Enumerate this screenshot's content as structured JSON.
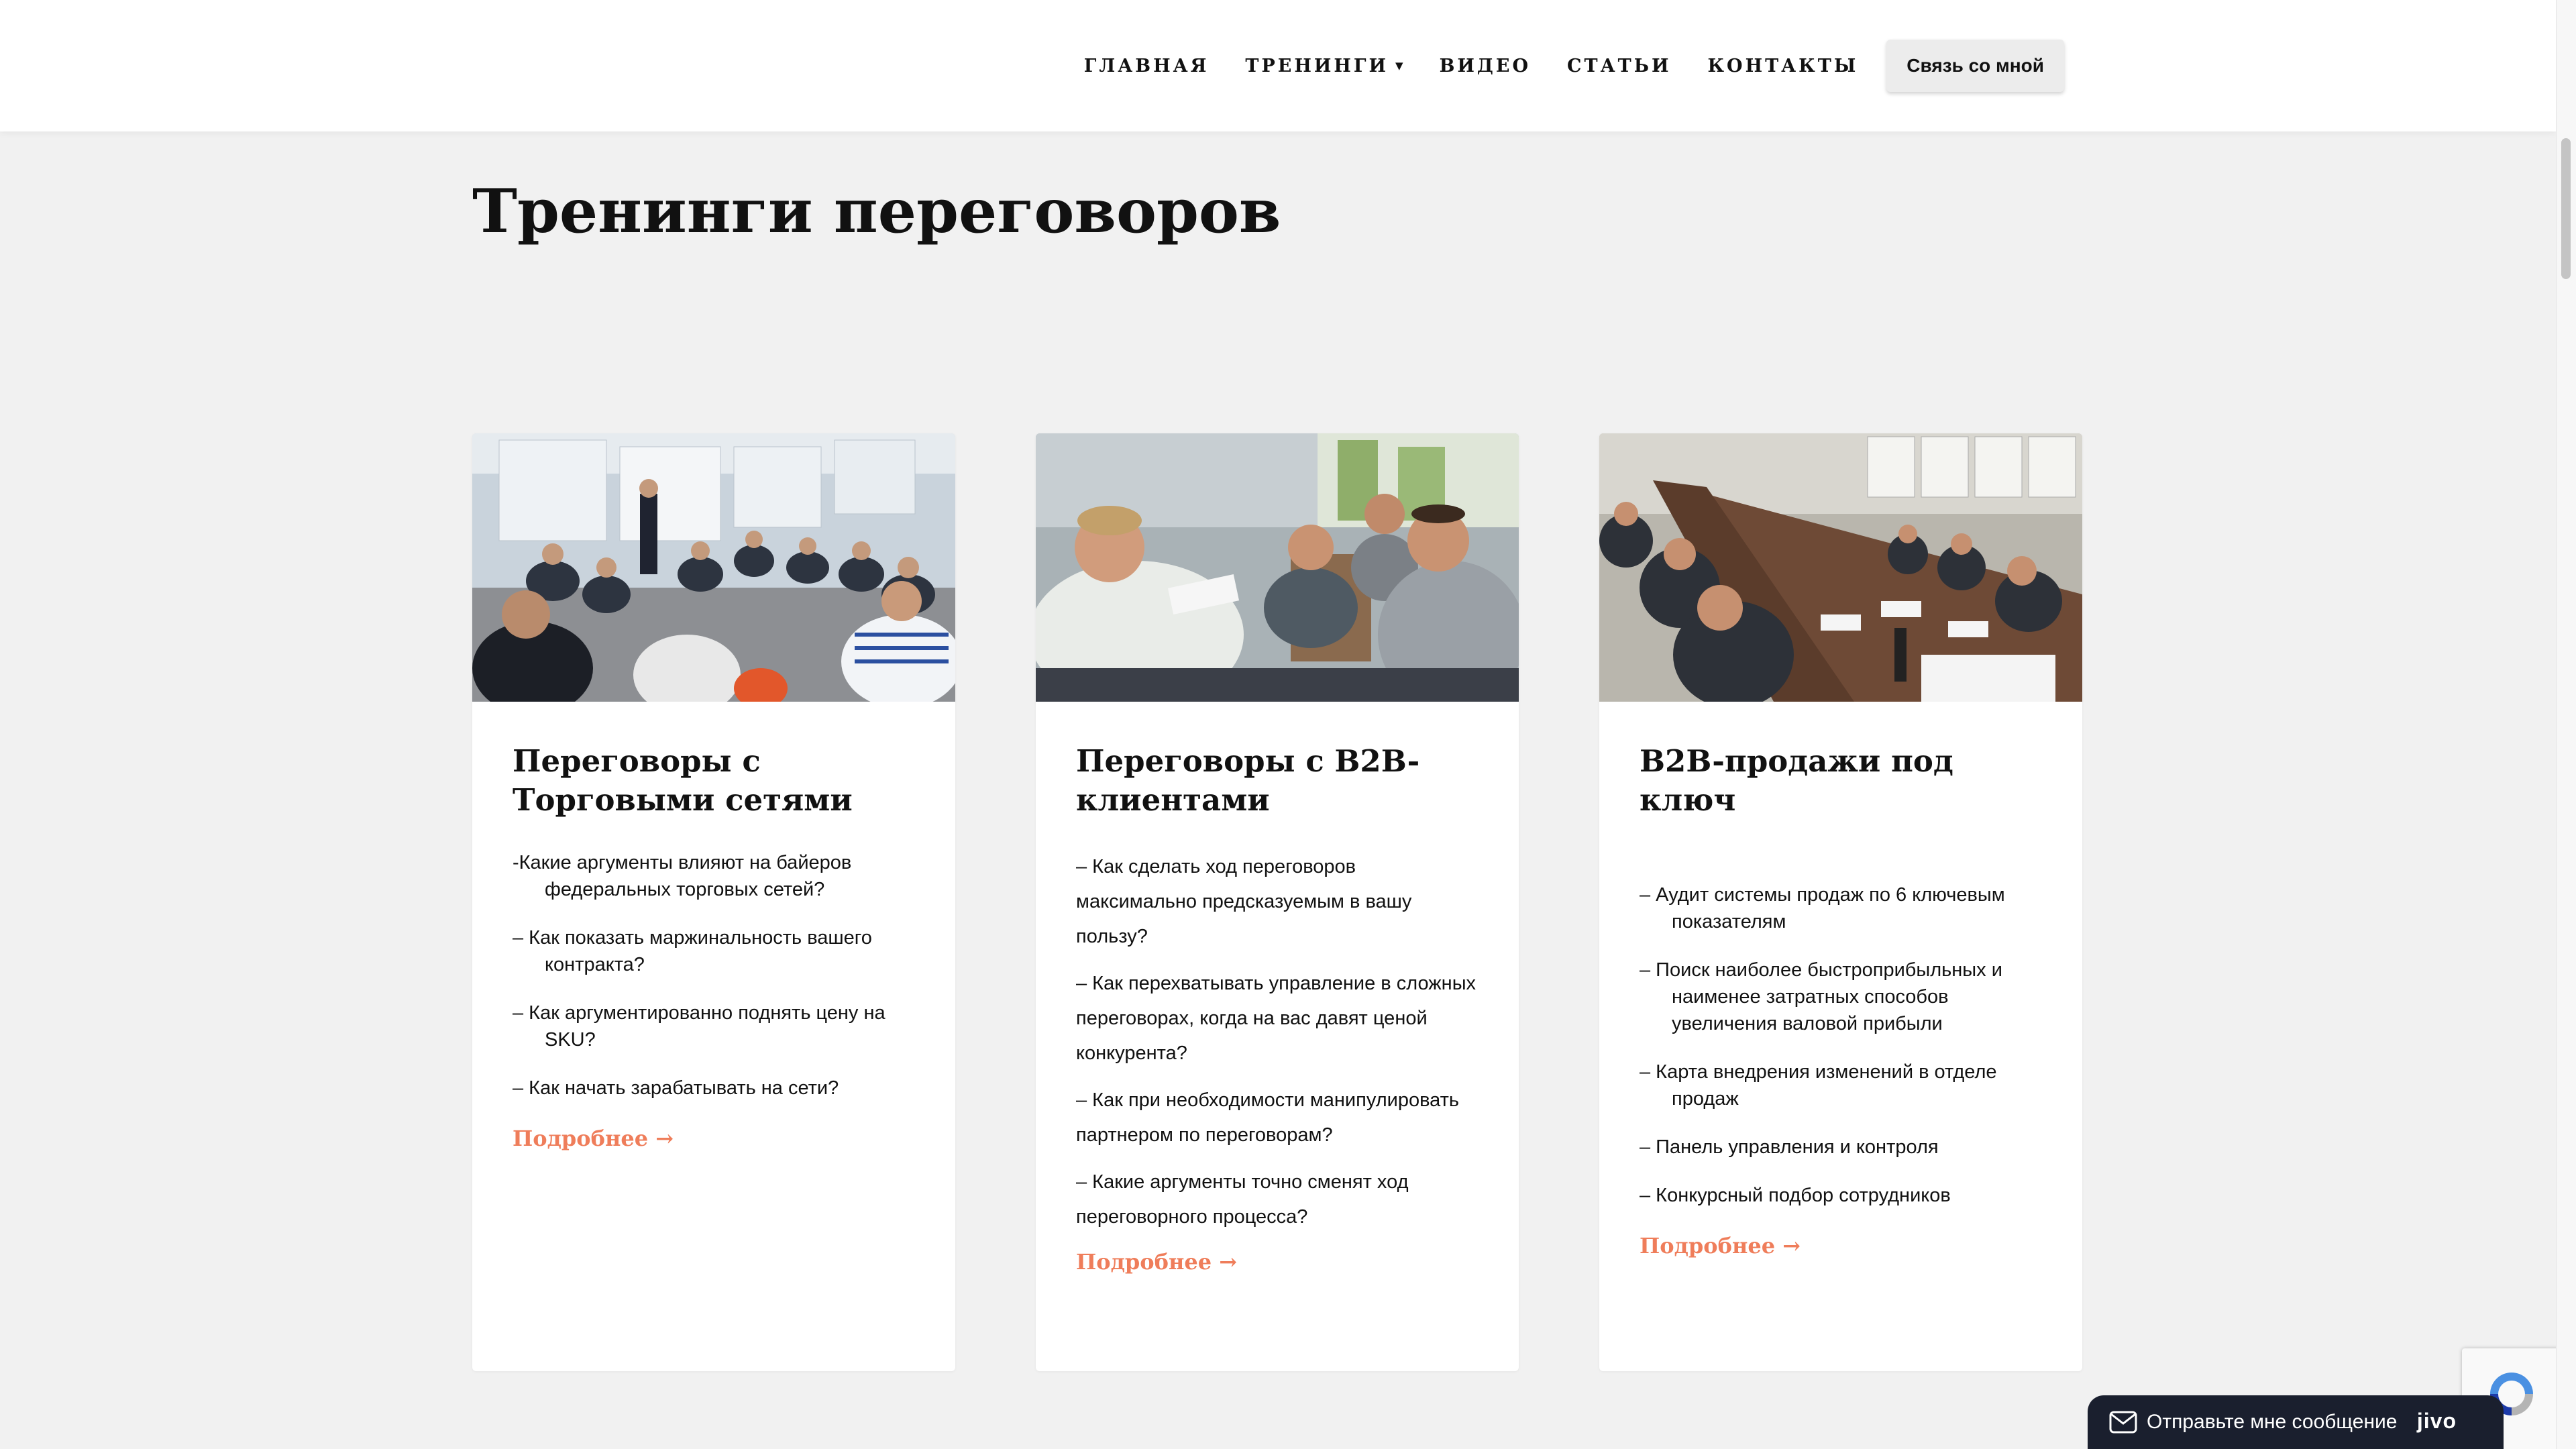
{
  "nav": {
    "items": [
      {
        "label": "ГЛАВНАЯ"
      },
      {
        "label": "ТРЕНИНГИ",
        "has_dropdown": true
      },
      {
        "label": "ВИДЕО"
      },
      {
        "label": "СТАТЬИ"
      },
      {
        "label": "КОНТАКТЫ"
      }
    ],
    "contact_button": "Связь со мной"
  },
  "page": {
    "title": "Тренинги переговоров"
  },
  "cards": [
    {
      "title": "Переговоры с Торговыми сетями",
      "bullets": [
        "-Какие аргументы влияют на байеров федеральных торговых сетей?",
        "– Как показать маржинальность вашего контракта?",
        "– Как аргументированно поднять цену на SKU?",
        "– Как начать зарабатывать на сети?"
      ],
      "link": "Подробнее →"
    },
    {
      "title": "Переговоры с B2B-клиентами",
      "bullets": [
        "– Как сделать ход переговоров максимально предсказуемым в вашу пользу?",
        "– Как перехватывать управление в сложных переговорах, когда на вас давят ценой конкурента?",
        "– Как при необходимости манипулировать партнером по переговорам?",
        "– Какие аргументы точно сменят ход переговорного процесса?"
      ],
      "link": "Подробнее →"
    },
    {
      "title": "B2B-продажи под ключ",
      "bullets": [
        "– Аудит системы продаж по 6 ключевым показателям",
        "– Поиск наиболее быстроприбыльных и наименее затратных способов увеличения валовой прибыли",
        "– Карта внедрения изменений в отделе продаж",
        "– Панель управления и контроля",
        "– Конкурсный подбор сотрудников"
      ],
      "link": "Подробнее →"
    }
  ],
  "chat_widget": {
    "label": "Отправьте мне сообщение",
    "brand": "jivo"
  },
  "icons": {
    "chat": "mail-icon",
    "captcha": "recaptcha-icon",
    "dropdown": "caret-down-icon"
  },
  "colors": {
    "accent_link": "#ef7d5a",
    "background": "#f1f1f1",
    "chat_bar": "#1a1f2e"
  }
}
